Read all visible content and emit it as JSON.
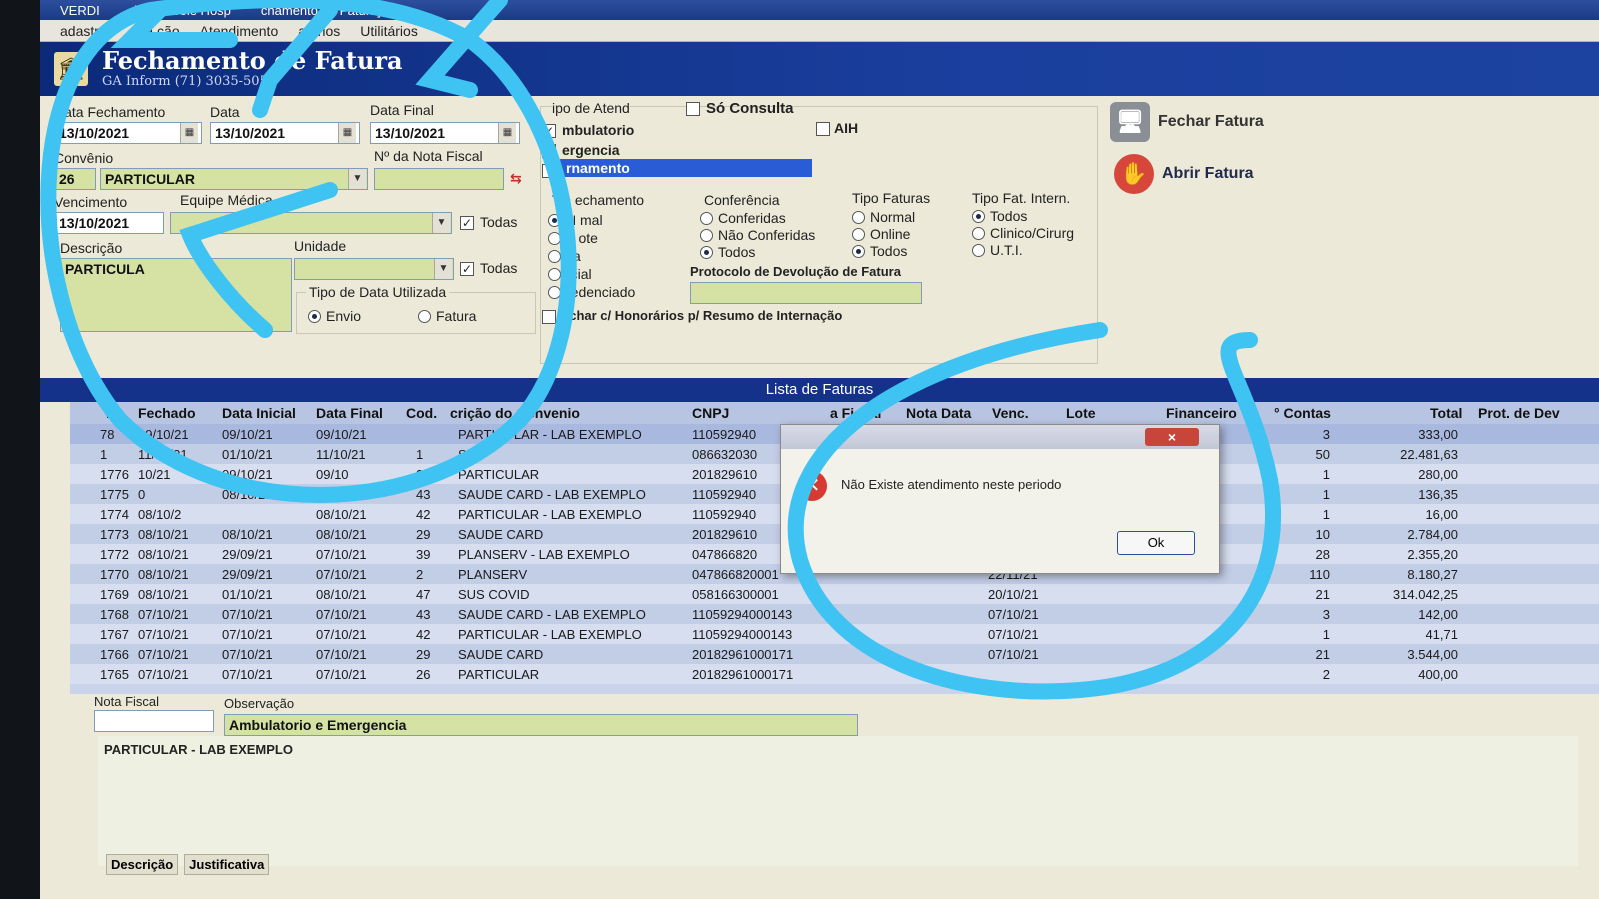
{
  "window": {
    "title_left": "VERDI",
    "title_mid": "de Controle Hosp",
    "title_right": "chamento de Fatura]"
  },
  "menu": [
    "adastros",
    "Ma  ção",
    "Atendimento",
    "atórios",
    "Utilitários"
  ],
  "banner": {
    "title": "Fechamento de Fatura",
    "subtitle": "GA Inform  (71) 3035-5051"
  },
  "filters": {
    "data_fechamento_label": "Data Fechamento",
    "data_fechamento": "13/10/2021",
    "data_inicial_label": "Data",
    "data_inicial": "13/10/2021",
    "data_final_label": "Data Final",
    "data_final": "13/10/2021",
    "convenio_label": "Convênio",
    "convenio_code": "26",
    "convenio_name": "PARTICULAR",
    "nota_fiscal_label": "Nº da Nota Fiscal",
    "vencimento_label": "Vencimento",
    "vencimento": "13/10/2021",
    "equipe_label": "Equipe Médica",
    "todas_1": "Todas",
    "descricao_label": "Descrição",
    "descricao": "PARTICULA",
    "unidade_label": "Unidade",
    "todas_2": "Todas",
    "tipo_data_label": "Tipo de Data Utilizada",
    "tipo_data_envio": "Envio",
    "tipo_data_fatura": "Fatura"
  },
  "atendimento": {
    "label": "ipo de Atend",
    "so_consulta": "Só Consulta",
    "ambulatorio": "mbulatorio",
    "emergencia": "ergencia",
    "internamento": "rnamento",
    "aih": "AIH"
  },
  "fechamento": {
    "label": "Tip  echamento",
    "options": [
      "N  mal",
      "F  ote",
      "  sa",
      "  rcial",
      "redenciado"
    ]
  },
  "conferencia": {
    "label": "Conferência",
    "options": [
      "Conferidas",
      "Não Conferidas",
      "Todos"
    ]
  },
  "tipo_faturas": {
    "label": "Tipo Faturas",
    "options": [
      "Normal",
      "Online",
      "Todos"
    ]
  },
  "tipo_fat_intern": {
    "label": "Tipo Fat. Intern.",
    "options": [
      "Todos",
      "Clinico/Cirurg",
      "U.T.I."
    ]
  },
  "protocolo_label": "Protocolo de Devolução de Fatura",
  "honorarios_label": "echar c/ Honorários p/ Resumo de Internação",
  "actions": {
    "fechar": "Fechar Fatura",
    "abrir": "Abrir Fatura"
  },
  "list": {
    "title": "Lista de Faturas",
    "columns": [
      "m.",
      "Fechado",
      "Data Inicial",
      "Data Final",
      "Cod.",
      "  crição do Convenio",
      "CNPJ",
      "a Fiscal",
      "Nota Data",
      "Venc.",
      "Lote",
      "Financeiro",
      "° Contas",
      "Total",
      "Prot. de Dev"
    ],
    "rows": [
      {
        "num": "78",
        "fechado": "09/10/21",
        "ini": "09/10/21",
        "fim": "09/10/21",
        "cod": "",
        "conv": "PARTICULAR - LAB EXEMPLO",
        "cnpj": "110592940",
        "venc": "",
        "contas": "3",
        "total": "333,00"
      },
      {
        "num": "1",
        "fechado": "11/10/21",
        "ini": "01/10/21",
        "fim": "11/10/21",
        "cod": "1",
        "conv": "SUS",
        "cnpj": "086632030",
        "venc": "",
        "contas": "50",
        "total": "22.481,63"
      },
      {
        "num": "1776",
        "fechado": "  10/21",
        "ini": "09/10/21",
        "fim": "09/10",
        "cod": "26",
        "conv": "PARTICULAR",
        "cnpj": "201829610",
        "venc": "",
        "contas": "1",
        "total": "280,00"
      },
      {
        "num": "1775",
        "fechado": "0",
        "ini": "08/10/21",
        "fim": "  21",
        "cod": "43",
        "conv": "SAUDE CARD - LAB EXEMPLO",
        "cnpj": "110592940",
        "venc": "",
        "contas": "1",
        "total": "136,35"
      },
      {
        "num": "1774",
        "fechado": "08/10/2",
        "ini": "",
        "fim": "08/10/21",
        "cod": "42",
        "conv": "PARTICULAR - LAB EXEMPLO",
        "cnpj": "110592940",
        "venc": "",
        "contas": "1",
        "total": "16,00"
      },
      {
        "num": "1773",
        "fechado": "08/10/21",
        "ini": "08/10/21",
        "fim": "08/10/21",
        "cod": "29",
        "conv": "SAUDE CARD",
        "cnpj": "201829610",
        "venc": "",
        "contas": "10",
        "total": "2.784,00"
      },
      {
        "num": "1772",
        "fechado": "08/10/21",
        "ini": "29/09/21",
        "fim": "07/10/21",
        "cod": "39",
        "conv": "PLANSERV - LAB EXEMPLO",
        "cnpj": "047866820",
        "venc": "",
        "contas": "28",
        "total": "2.355,20"
      },
      {
        "num": "1770",
        "fechado": "08/10/21",
        "ini": "29/09/21",
        "fim": "07/10/21",
        "cod": "2",
        "conv": "PLANSERV",
        "cnpj": "047866820001",
        "venc": "22/11/21",
        "contas": "110",
        "total": "8.180,27"
      },
      {
        "num": "1769",
        "fechado": "08/10/21",
        "ini": "01/10/21",
        "fim": "08/10/21",
        "cod": "47",
        "conv": "SUS COVID",
        "cnpj": "058166300001",
        "venc": "20/10/21",
        "contas": "21",
        "total": "314.042,25"
      },
      {
        "num": "1768",
        "fechado": "07/10/21",
        "ini": "07/10/21",
        "fim": "07/10/21",
        "cod": "43",
        "conv": "SAUDE CARD - LAB EXEMPLO",
        "cnpj": "11059294000143",
        "venc": "07/10/21",
        "contas": "3",
        "total": "142,00"
      },
      {
        "num": "1767",
        "fechado": "07/10/21",
        "ini": "07/10/21",
        "fim": "07/10/21",
        "cod": "42",
        "conv": "PARTICULAR - LAB EXEMPLO",
        "cnpj": "11059294000143",
        "venc": "07/10/21",
        "contas": "1",
        "total": "41,71"
      },
      {
        "num": "1766",
        "fechado": "07/10/21",
        "ini": "07/10/21",
        "fim": "07/10/21",
        "cod": "29",
        "conv": "SAUDE CARD",
        "cnpj": "20182961000171",
        "venc": "07/10/21",
        "contas": "21",
        "total": "3.544,00"
      },
      {
        "num": "1765",
        "fechado": "07/10/21",
        "ini": "07/10/21",
        "fim": "07/10/21",
        "cod": "26",
        "conv": "PARTICULAR",
        "cnpj": "20182961000171",
        "venc": "",
        "contas": "2",
        "total": "400,00"
      }
    ]
  },
  "footer": {
    "nota_fiscal_label": "Nota Fiscal",
    "observacao_label": "Observação",
    "observacao": "Ambulatorio e Emergencia",
    "memo": "PARTICULAR - LAB EXEMPLO",
    "tabs": [
      "Descrição",
      "Justificativa"
    ]
  },
  "dialog": {
    "message": "Não Existe atendimento neste periodo",
    "ok": "Ok",
    "close": "×"
  },
  "colors": {
    "annotation": "#3fc3f2",
    "banner": "#15328a",
    "field_yellow": "#d6e1a4"
  }
}
